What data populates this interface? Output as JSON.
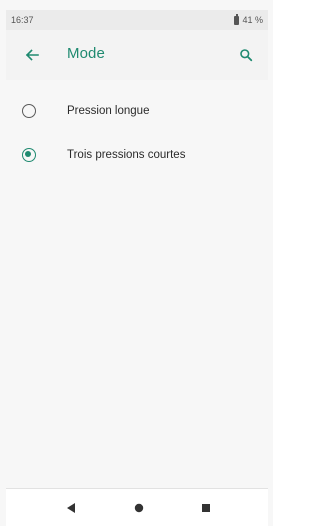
{
  "status_bar": {
    "time": "16:37",
    "battery": "41 %"
  },
  "app_bar": {
    "title": "Mode",
    "back_icon": "arrow-back-icon",
    "search_icon": "search-icon"
  },
  "options": [
    {
      "label": "Pression longue",
      "selected": false
    },
    {
      "label": "Trois pressions courtes",
      "selected": true
    }
  ],
  "nav_bar": {
    "back_icon": "nav-back-triangle-icon",
    "home_icon": "nav-home-circle-icon",
    "recents_icon": "nav-recents-square-icon"
  },
  "colors": {
    "accent": "#1f8a70",
    "app_bar_bg": "#f3f3f3",
    "status_bar_bg": "#ebebeb",
    "nav_icon": "#333333"
  }
}
